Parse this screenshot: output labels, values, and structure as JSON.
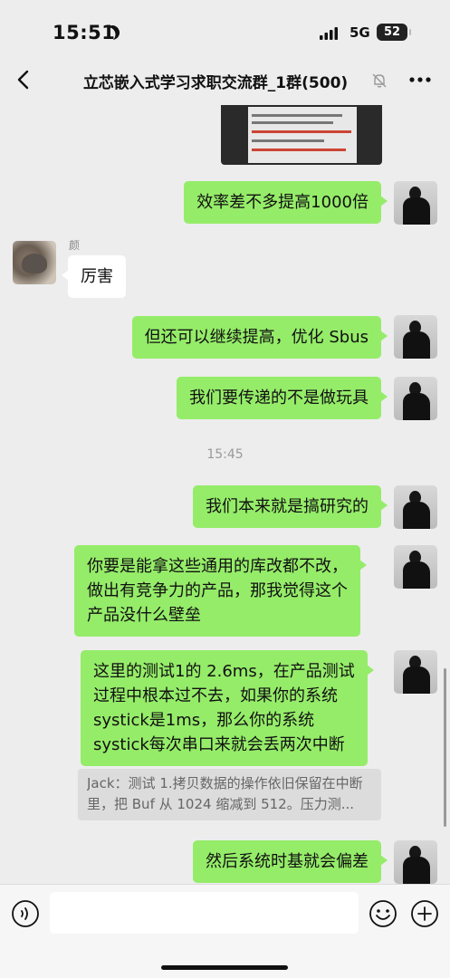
{
  "status_bar": {
    "time": "15:51",
    "network": "5G",
    "battery": "52"
  },
  "header": {
    "title": "立芯嵌入式学习求职交流群_1群(500)",
    "icons": [
      "back-icon",
      "mute-bell-icon",
      "more-icon"
    ]
  },
  "messages": [
    {
      "side": "me",
      "text": "效率差不多提高1000倍"
    },
    {
      "side": "other",
      "sender": "颜",
      "text": "厉害"
    },
    {
      "side": "me",
      "text": "但还可以继续提高，优化 Sbus"
    },
    {
      "side": "me",
      "text": "我们要传递的不是做玩具"
    },
    {
      "side": "me",
      "text": "我们本来就是搞研究的"
    },
    {
      "side": "me",
      "lines": [
        "你要是能拿这些通用的库改都不改，",
        "做出有竞争力的产品，那我觉得这个",
        "产品没什么壁垒"
      ]
    },
    {
      "side": "me",
      "lines": [
        "这里的测试1的 2.6ms，在产品测试",
        "过程中根本过不去，如果你的系统",
        "systick是1ms，那么你的系统",
        "systick每次串口来就会丢两次中断"
      ]
    },
    {
      "side": "me",
      "text": "然后系统时基就会偏差"
    }
  ],
  "timestamp": "15:45",
  "quote": {
    "text": "Jack：测试 1.拷贝数据的操作依旧保留在中断里，把 Buf 从 1024 缩减到 512。压力测..."
  },
  "input_bar": {
    "placeholder": "",
    "icons": [
      "voice-icon",
      "emoji-icon",
      "plus-icon"
    ]
  }
}
